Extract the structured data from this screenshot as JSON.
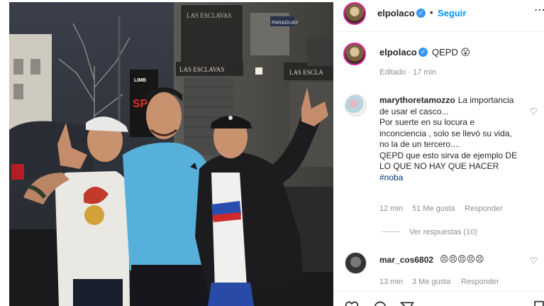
{
  "header": {
    "username": "elpolaco",
    "verified_icon": "verified-badge-icon",
    "separator": "•",
    "follow_label": "Seguir",
    "more_icon": "more-options-icon"
  },
  "caption": {
    "username": "elpolaco",
    "text": "QEPD 😮",
    "meta": "Editado · 17 min"
  },
  "comments": [
    {
      "username": "marythoretamozzo",
      "lines": [
        "La importancia",
        "de usar el casco...",
        "Por suerte en su locura e",
        "inconciencia , solo se llevó su vida,",
        "no la de un tercero....",
        "QEPD que esto sirva de ejemplo DE",
        "LO QUE NO HAY QUE HACER"
      ],
      "hashtag": "#noba",
      "time": "12 min",
      "likes": "51 Me gusta",
      "reply_label": "Responder",
      "like_icon": "heart-outline-icon",
      "view_replies": "Ver respuestas (10)"
    },
    {
      "username": "mar_cos6802",
      "text": "😣😣😣😣😣",
      "time": "13 min",
      "likes": "3 Me gusta",
      "reply_label": "Responder",
      "like_icon": "heart-outline-icon"
    }
  ],
  "action_bar": {
    "like_icon": "heart-outline-icon",
    "comment_icon": "comment-icon",
    "share_icon": "share-icon",
    "save_icon": "bookmark-icon"
  },
  "photo": {
    "signs": [
      "LAS ESCLAVAS",
      "LAS ESCLAVAS",
      "LAS ESCLA",
      "PARAGUAY"
    ]
  }
}
